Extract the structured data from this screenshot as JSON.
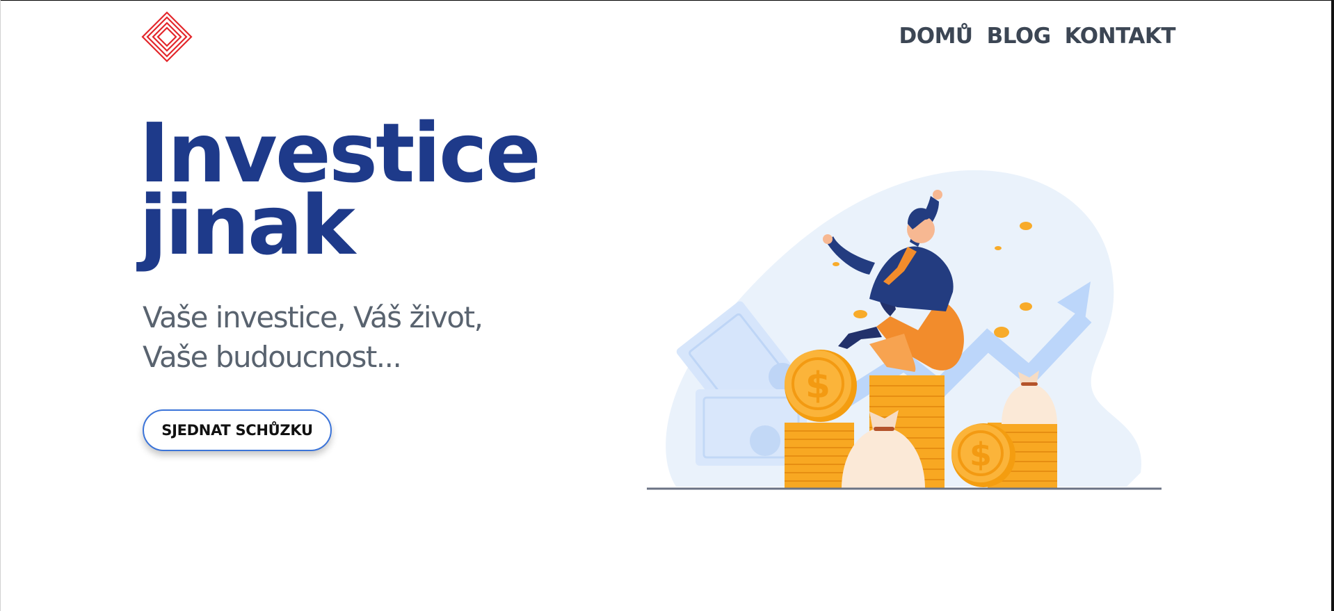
{
  "nav": {
    "items": [
      {
        "label": "DOMŮ"
      },
      {
        "label": "BLOG"
      },
      {
        "label": "KONTAKT"
      }
    ]
  },
  "hero": {
    "title_line1": "Investice",
    "title_line2": "jinak",
    "subtitle_line1": "Vaše investice, Váš život,",
    "subtitle_line2": "Vaše budoucnost...",
    "cta_label": "SJEDNAT SCHŮZKU"
  },
  "colors": {
    "brand_blue": "#1e3a8a",
    "logo_red": "#e3262b",
    "cta_border": "#3b74d9",
    "nav_text": "#3c4654",
    "coin_gold": "#fbb02d"
  },
  "icons": {
    "logo": "nested-diamond-logo",
    "coin_symbol": "$"
  }
}
